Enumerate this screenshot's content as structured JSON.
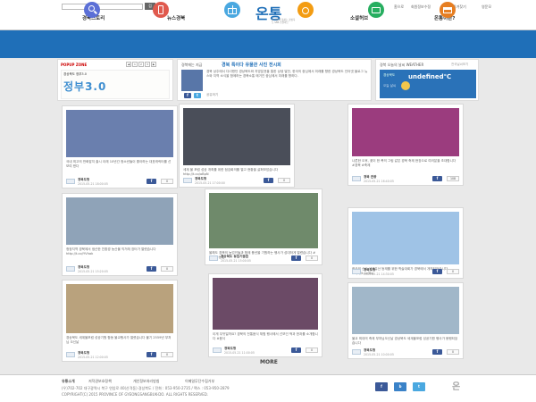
{
  "header": {
    "search_placeholder": "",
    "search_button": "검",
    "topnav": [
      "홈으로",
      "회원정보수정",
      "대국민즐겨찾기",
      "영문모"
    ],
    "nav": [
      "경북스토리",
      "뉴스경북",
      "소셜허브",
      "온통이란?"
    ],
    "logo_text": "온통",
    "logo_sub": "온 국민과 통하는 경상북도 SNS 소셜허브"
  },
  "menu": [
    {
      "label": "생활의 팁",
      "color": "#5b6fd6",
      "icon": "search-icon"
    },
    {
      "label": "추천앱",
      "color": "#e05a4e",
      "icon": "tablet-icon"
    },
    {
      "label": "이벤트",
      "color": "#4aa8e0",
      "icon": "gift-icon"
    },
    {
      "label": "공모정보",
      "color": "#f39c12",
      "icon": "medal-icon"
    },
    {
      "label": "여행정보",
      "color": "#27ae60",
      "icon": "camera-icon"
    },
    {
      "label": "착한업소",
      "color": "#e67e22",
      "icon": "store-icon"
    }
  ],
  "popup": {
    "title": "POPUP ZONE",
    "pages": [
      "1",
      "2",
      "3"
    ],
    "banner_top": "경상북도 정부3.0",
    "banner_big": "정부3.0"
  },
  "notice": {
    "label": "경북에는 지금",
    "text": "경북 특이다 유물관 사진 전시회",
    "body": "경북 상주에서 다녀왔던 경상북도와 지방분권을 통한 상생 발전, 한국의 중심에서 미래를 향한 경상북도 인터넷 블로그 뉴스와 지역 소식을 함께하는 경북소통 매거진 중심에서 미래를 향하다.",
    "share": "공유하기"
  },
  "weather": {
    "label": "경북 오늘의 날씨 WEATHER",
    "link": "전국날씨보기",
    "place": "경상북도",
    "temp": "undefined℃",
    "sub": "오늘 날씨"
  },
  "cards": [
    {
      "text": "국내 최고의 만화잡지 출시 이래 10년간 청소년들이 좋아하는 대표캐릭터를 선보여 왔다",
      "name": "경북도청",
      "date": "2015-05-21 18:00:05",
      "count": "0",
      "photo": "#6a7fae"
    },
    {
      "text": "세계 물 포럼 성공 개최를 위한 점검회의를 열고 현황을 살펴보았습니다 http://t.co/oBpN",
      "name": "경북도청",
      "date": "2015-05-21 17:00:00",
      "count": "0",
      "photo": "#4a4e59"
    },
    {
      "text": "나른한 오후, 꽃이 한 폭의 그림 같은 경북 축제 현장으로 여러분을 초대합니다 #경북 #축제",
      "name": "경북 관광",
      "date": "2015-05-21 16:40:05",
      "count": "108",
      "photo": "#9b3c7e"
    },
    {
      "text": "청정지역 경북에서 생산한 친환경 농산물 직거래 장터가 열렸습니다 http://t.co/YVhak",
      "name": "경북도청",
      "date": "2015-05-21 15:20:05",
      "count": "0",
      "photo": "#8fa3b8"
    },
    {
      "text": "올해도 경북의 농업인들과 함께 풍년을 기원하는 행사가 성대하게 열렸습니다 #경북 #농업",
      "name": "경상북도 농업기술원",
      "date": "2015-05-21 15:00:05",
      "count": "0",
      "photo": "#6f8a6b"
    },
    {
      "text": "한국의 산사 세계유산 등재를 위한 학술대회가 경북에서 개최되었습니다 http://t.co/Bq",
      "name": "경북도청",
      "date": "2015-05-21 14:30:05",
      "count": "0",
      "photo": "#9fc3e6"
    },
    {
      "text": "경상북도 세계물포럼 성공기원 합동 불교행사가 열렸습니다 불기 2559년 부처님 오신날",
      "name": "경북도청",
      "date": "2015-05-21 12:00:05",
      "count": "0",
      "photo": "#b9a27d"
    },
    {
      "text": "이게 무엇일까요? 경북의 전통음식 체험 행사에서 선보인 떡과 한과를 소개합니다 #음식",
      "name": "경북도청",
      "date": "2015-05-21 11:00:05",
      "count": "0",
      "photo": "#6b4a66"
    },
    {
      "text": "불교 최대의 축제 부처님오신날 경상북도 세계물포럼 성공기원 행사가 봉행되었습니다",
      "name": "경북도청",
      "date": "2015-05-21 10:00:05",
      "count": "0",
      "photo": "#a1b7c9"
    }
  ],
  "more": "MORE",
  "footer": {
    "links": [
      "유통소개",
      "저작권보호정책",
      "개인정보처리방침",
      "이메일무단수집거부"
    ],
    "address": "(우)702-702 대구광역시 북구 연암로 40(산격동) 경상북도 / 전화 : 053-950-2735 / 팩스 : 053-950-2879",
    "copyright": "COPYRIGHT(C) 2015 PROVINCE OF GYEONGSANGBUK-DO. ALL RIGHTS RESERVED."
  }
}
